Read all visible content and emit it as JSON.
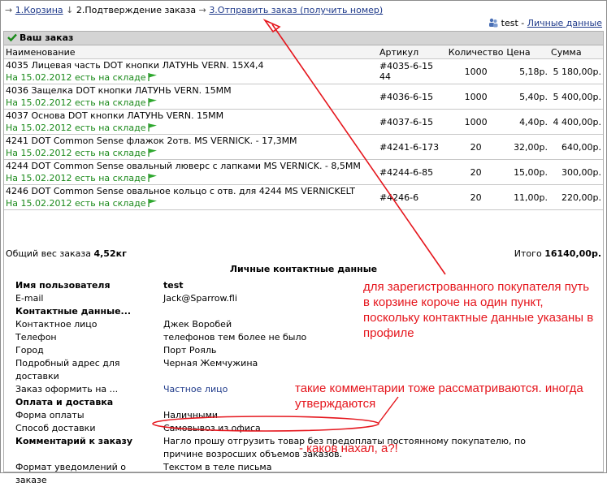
{
  "steps": {
    "step1": "1.Корзина",
    "step2": "2.Подтверждение заказа",
    "step3": "3.Отправить заказ (получить номер)"
  },
  "user": {
    "name": "test",
    "separator": "-",
    "link": "Личные данные"
  },
  "panel": {
    "title": "Ваш заказ"
  },
  "columns": [
    "Наименование",
    "Артикул",
    "Количество",
    "Цена",
    "Сумма"
  ],
  "items": [
    {
      "name": "4035 Лицевая часть DOT кнопки ЛАТУНЬ VERN. 15X4,4",
      "stock": "На 15.02.2012 есть на складе",
      "article": "#4035-6-15 44",
      "qty": "1000",
      "price": "5,18р.",
      "sum": "5 180,00р."
    },
    {
      "name": "4036 Защелка DOT кнопки ЛАТУНЬ VERN. 15MM",
      "stock": "На 15.02.2012 есть на складе",
      "article": "#4036-6-15",
      "qty": "1000",
      "price": "5,40р.",
      "sum": "5 400,00р."
    },
    {
      "name": "4037 Основа DOT кнопки ЛАТУНЬ VERN. 15MM",
      "stock": "На 15.02.2012 есть на складе",
      "article": "#4037-6-15",
      "qty": "1000",
      "price": "4,40р.",
      "sum": "4 400,00р."
    },
    {
      "name": "4241 DOT Common Sense флажок 2отв. MS VERNICK. - 17,3MM",
      "stock": "На 15.02.2012 есть на складе",
      "article": "#4241-6-173",
      "qty": "20",
      "price": "32,00р.",
      "sum": "640,00р."
    },
    {
      "name": "4244 DOT Common Sense овальный люверс с лапками MS VERNICK. - 8,5MM",
      "stock": "На 15.02.2012 есть на складе",
      "article": "#4244-6-85",
      "qty": "20",
      "price": "15,00р.",
      "sum": "300,00р."
    },
    {
      "name": "4246 DOT Common Sense овальное кольцо с отв. для 4244 MS VERNICKELT",
      "stock": "На 15.02.2012 есть на складе",
      "article": "#4246-6",
      "qty": "20",
      "price": "11,00р.",
      "sum": "220,00р."
    }
  ],
  "totals": {
    "weight_label": "Общий вес заказа",
    "weight_value": "4,52кг",
    "total_label": "Итого",
    "total_value": "16140,00р."
  },
  "contacts": {
    "title": "Личные контактные данные",
    "rows": [
      {
        "label": "Имя пользователя",
        "value": "test",
        "header": true
      },
      {
        "label": "E-mail",
        "value": "Jack@Sparrow.fli"
      },
      {
        "label": "Контактные данные...",
        "value": "",
        "header": true
      },
      {
        "label": "Контактное лицо",
        "value": "Джек Воробей"
      },
      {
        "label": "Телефон",
        "value": "телефонов тем более не было"
      },
      {
        "label": "Город",
        "value": "Порт Рояль"
      },
      {
        "label": "Подробный адрес для доставки",
        "value": "Черная Жемчужина"
      },
      {
        "label": "Заказ оформить на ...",
        "value": "Частное лицо"
      },
      {
        "label": "Оплата и доставка",
        "value": "",
        "header": true
      },
      {
        "label": "Форма оплаты",
        "value": "Наличными"
      },
      {
        "label": "Способ доставки",
        "value": "Самовывоз из офиса"
      },
      {
        "label": "Комментарий к заказу",
        "value": "Нагло прошу отгрузить товар без предоплаты постоянному покупателю, по причине возросших объемов заказов.",
        "header": true
      },
      {
        "label": "Формат уведомлений о заказе",
        "value": "Текстом в теле письма"
      }
    ]
  },
  "annotations": {
    "note1": "для зарегистрованного покупателя путь в корзине короче на один пункт, поскольку контактные данные указаны в профиле",
    "note2": "такие комментарии тоже рассматриваются. иногда утверждаются",
    "note3": "- каков нахал, а?!"
  },
  "colors": {
    "annotation": "#e5161d",
    "stock": "#1a8a1a",
    "link": "#1f3a8a",
    "header_bg": "#d4d4d4"
  }
}
